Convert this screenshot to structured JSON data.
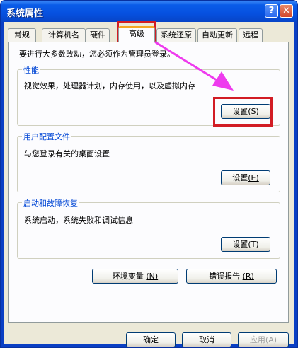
{
  "window": {
    "title": "系统属性",
    "help_glyph": "?",
    "close_glyph": "✕"
  },
  "tabs": [
    {
      "label": "常规"
    },
    {
      "label": "计算机名"
    },
    {
      "label": "硬件"
    },
    {
      "label": "高级",
      "active": true
    },
    {
      "label": "系统还原"
    },
    {
      "label": "自动更新"
    },
    {
      "label": "远程"
    }
  ],
  "advanced": {
    "notice": "要进行大多数改动，您必须作为管理员登录。",
    "performance": {
      "title": "性能",
      "desc": "视觉效果，处理器计划，内存使用，以及虚拟内存",
      "button": {
        "label": "设置",
        "mnemonic": "(S)"
      }
    },
    "user_profiles": {
      "title": "用户配置文件",
      "desc": "与您登录有关的桌面设置",
      "button": {
        "label": "设置",
        "mnemonic": "(E)"
      }
    },
    "startup_recovery": {
      "title": "启动和故障恢复",
      "desc": "系统启动，系统失败和调试信息",
      "button": {
        "label": "设置",
        "mnemonic": "(T)"
      }
    },
    "env_button": {
      "label": "环境变量",
      "mnemonic": "(N)"
    },
    "error_button": {
      "label": "错误报告",
      "mnemonic": "(R)"
    }
  },
  "footer": {
    "ok_label": "确定",
    "cancel_label": "取消",
    "apply_label": "应用(A)"
  },
  "colors": {
    "title_bar": "#0651e0",
    "highlight": "#d21c24",
    "arrow": "#ee3bee"
  }
}
